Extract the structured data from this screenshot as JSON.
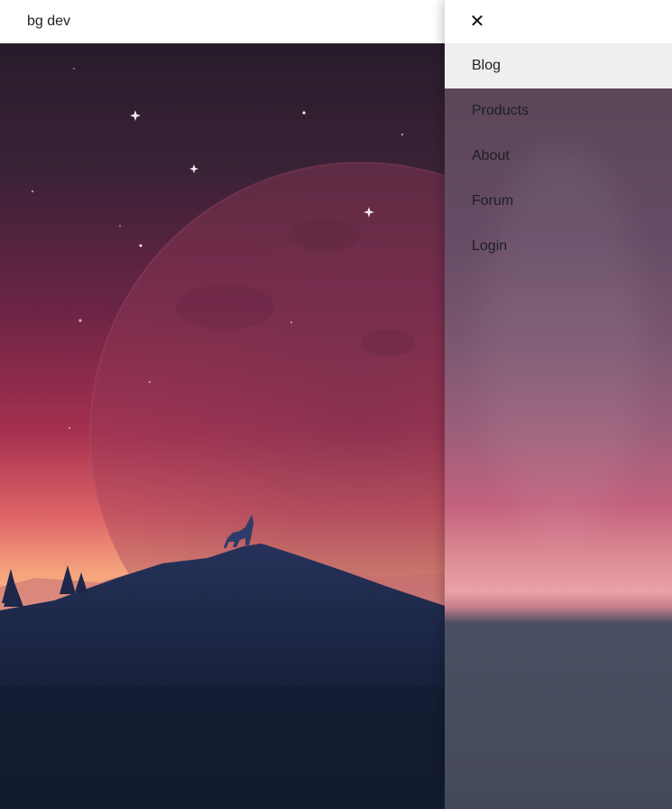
{
  "header": {
    "title": "bg dev"
  },
  "drawer": {
    "close_label": "✕",
    "items": [
      {
        "label": "Blog",
        "active": true
      },
      {
        "label": "Products",
        "active": false
      },
      {
        "label": "About",
        "active": false
      },
      {
        "label": "Forum",
        "active": false
      },
      {
        "label": "Login",
        "active": false
      }
    ]
  },
  "colors": {
    "sky_top": "#2a1e2e",
    "sky_mid": "#8a2b4f",
    "horizon": "#f4a37a",
    "mountain": "#1f2a4a",
    "ground": "#131d30",
    "drawer_active": "#efefef"
  }
}
